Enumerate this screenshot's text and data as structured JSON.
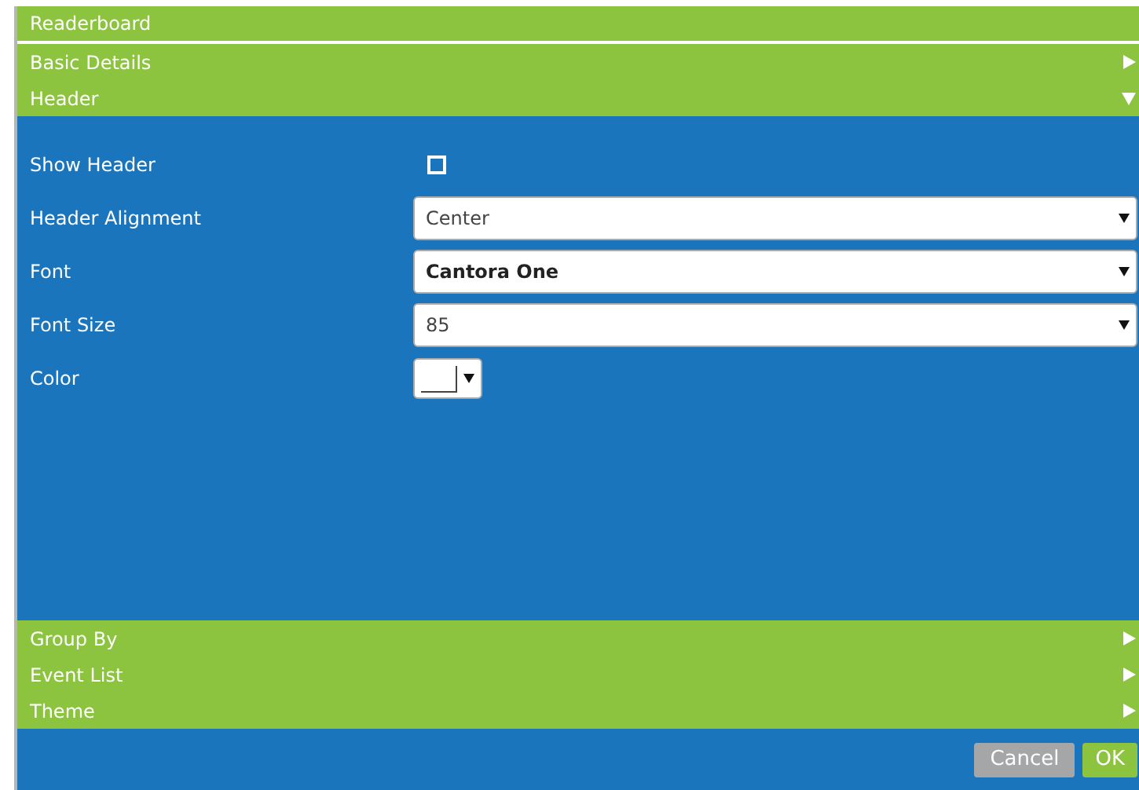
{
  "window": {
    "title": "Readerboard"
  },
  "sections": [
    {
      "label": "Basic Details",
      "expanded": false
    },
    {
      "label": "Header",
      "expanded": true,
      "fields": [
        {
          "kind": "checkbox",
          "label": "Show Header",
          "checked": false
        },
        {
          "kind": "select",
          "label": "Header Alignment",
          "value": "Center",
          "bold": false
        },
        {
          "kind": "select",
          "label": "Font",
          "value": "Cantora One",
          "bold": true
        },
        {
          "kind": "select",
          "label": "Font Size",
          "value": "85",
          "bold": false
        },
        {
          "kind": "color",
          "label": "Color"
        }
      ]
    },
    {
      "label": "Group By",
      "expanded": false
    },
    {
      "label": "Event List",
      "expanded": false
    },
    {
      "label": "Theme",
      "expanded": false
    }
  ],
  "buttons": [
    {
      "label": "Cancel",
      "kind": "secondary"
    },
    {
      "label": "OK",
      "kind": "primary"
    }
  ]
}
